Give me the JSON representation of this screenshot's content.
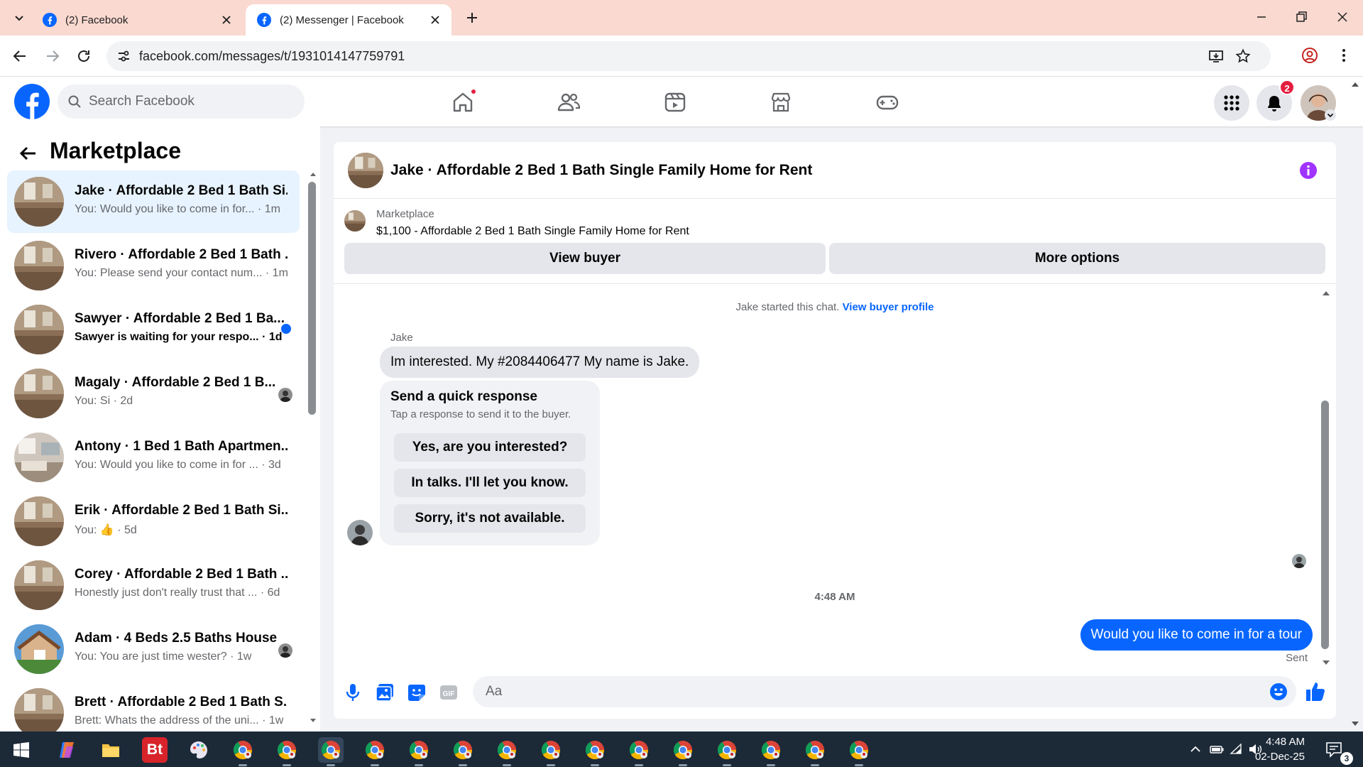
{
  "browser": {
    "tabs": [
      {
        "title": "(2) Facebook"
      },
      {
        "title": "(2) Messenger | Facebook"
      }
    ],
    "url": "facebook.com/messages/t/1931014147759791"
  },
  "header": {
    "search_placeholder": "Search Facebook",
    "notifications_count": "2"
  },
  "sidebar": {
    "title": "Marketplace",
    "conversations": [
      {
        "title": "Jake · Affordable 2 Bed 1 Bath Si...",
        "snippet": "You: Would you like to come in for... · 1m",
        "active": true
      },
      {
        "title": "Rivero · Affordable 2 Bed 1 Bath ...",
        "snippet": "You: Please send your contact num... · 1m"
      },
      {
        "title": "Sawyer · Affordable 2 Bed 1 Ba...",
        "snippet": "Sawyer is waiting for your respo... · 1d",
        "unread": true
      },
      {
        "title": "Magaly · Affordable 2 Bed 1 B...",
        "snippet": "You: Si · 2d"
      },
      {
        "title": "Antony · 1 Bed 1 Bath Apartmen...",
        "snippet": "You: Would you like to come in for ... · 3d"
      },
      {
        "title": "Erik · Affordable 2 Bed 1 Bath Si...",
        "snippet": "You: 👍 · 5d"
      },
      {
        "title": "Corey · Affordable 2 Bed 1 Bath ...",
        "snippet": "Honestly just don't really trust that ... · 6d"
      },
      {
        "title": "Adam · 4 Beds 2.5 Baths House",
        "snippet": "You: You are just time wester? · 1w"
      },
      {
        "title": "Brett · Affordable 2 Bed 1 Bath S...",
        "snippet": "Brett: Whats the address of the uni... · 1w"
      }
    ]
  },
  "chat": {
    "title": "Jake · Affordable 2 Bed 1 Bath Single Family Home for Rent",
    "listing_source": "Marketplace",
    "listing_text": "$1,100 - Affordable 2 Bed 1 Bath Single Family Home for Rent",
    "view_buyer": "View buyer",
    "more_options": "More options",
    "started_text": "Jake started this chat.",
    "view_profile": "View buyer profile",
    "sender_name": "Jake",
    "message_in": "Im interested.  My #2084406477 My name is Jake.",
    "quick_title": "Send a quick response",
    "quick_sub": "Tap a response to send it to the buyer.",
    "quick_responses": [
      "Yes, are you interested?",
      "In talks. I'll let you know.",
      "Sorry, it's not available."
    ],
    "timestamp": "4:48 AM",
    "message_out": "Would you like to come in for a tour",
    "sent_label": "Sent",
    "input_placeholder": "Aa"
  },
  "taskbar": {
    "time": "4:48 AM",
    "date": "02-Dec-25",
    "notifications": "3",
    "bt_label": "Bt"
  },
  "colors": {
    "fb_blue": "#0866ff",
    "tabbar": "#fad9d0",
    "active_conv": "#e7f3ff",
    "info_purple": "#a033ff",
    "taskbar": "#1c2a38"
  }
}
